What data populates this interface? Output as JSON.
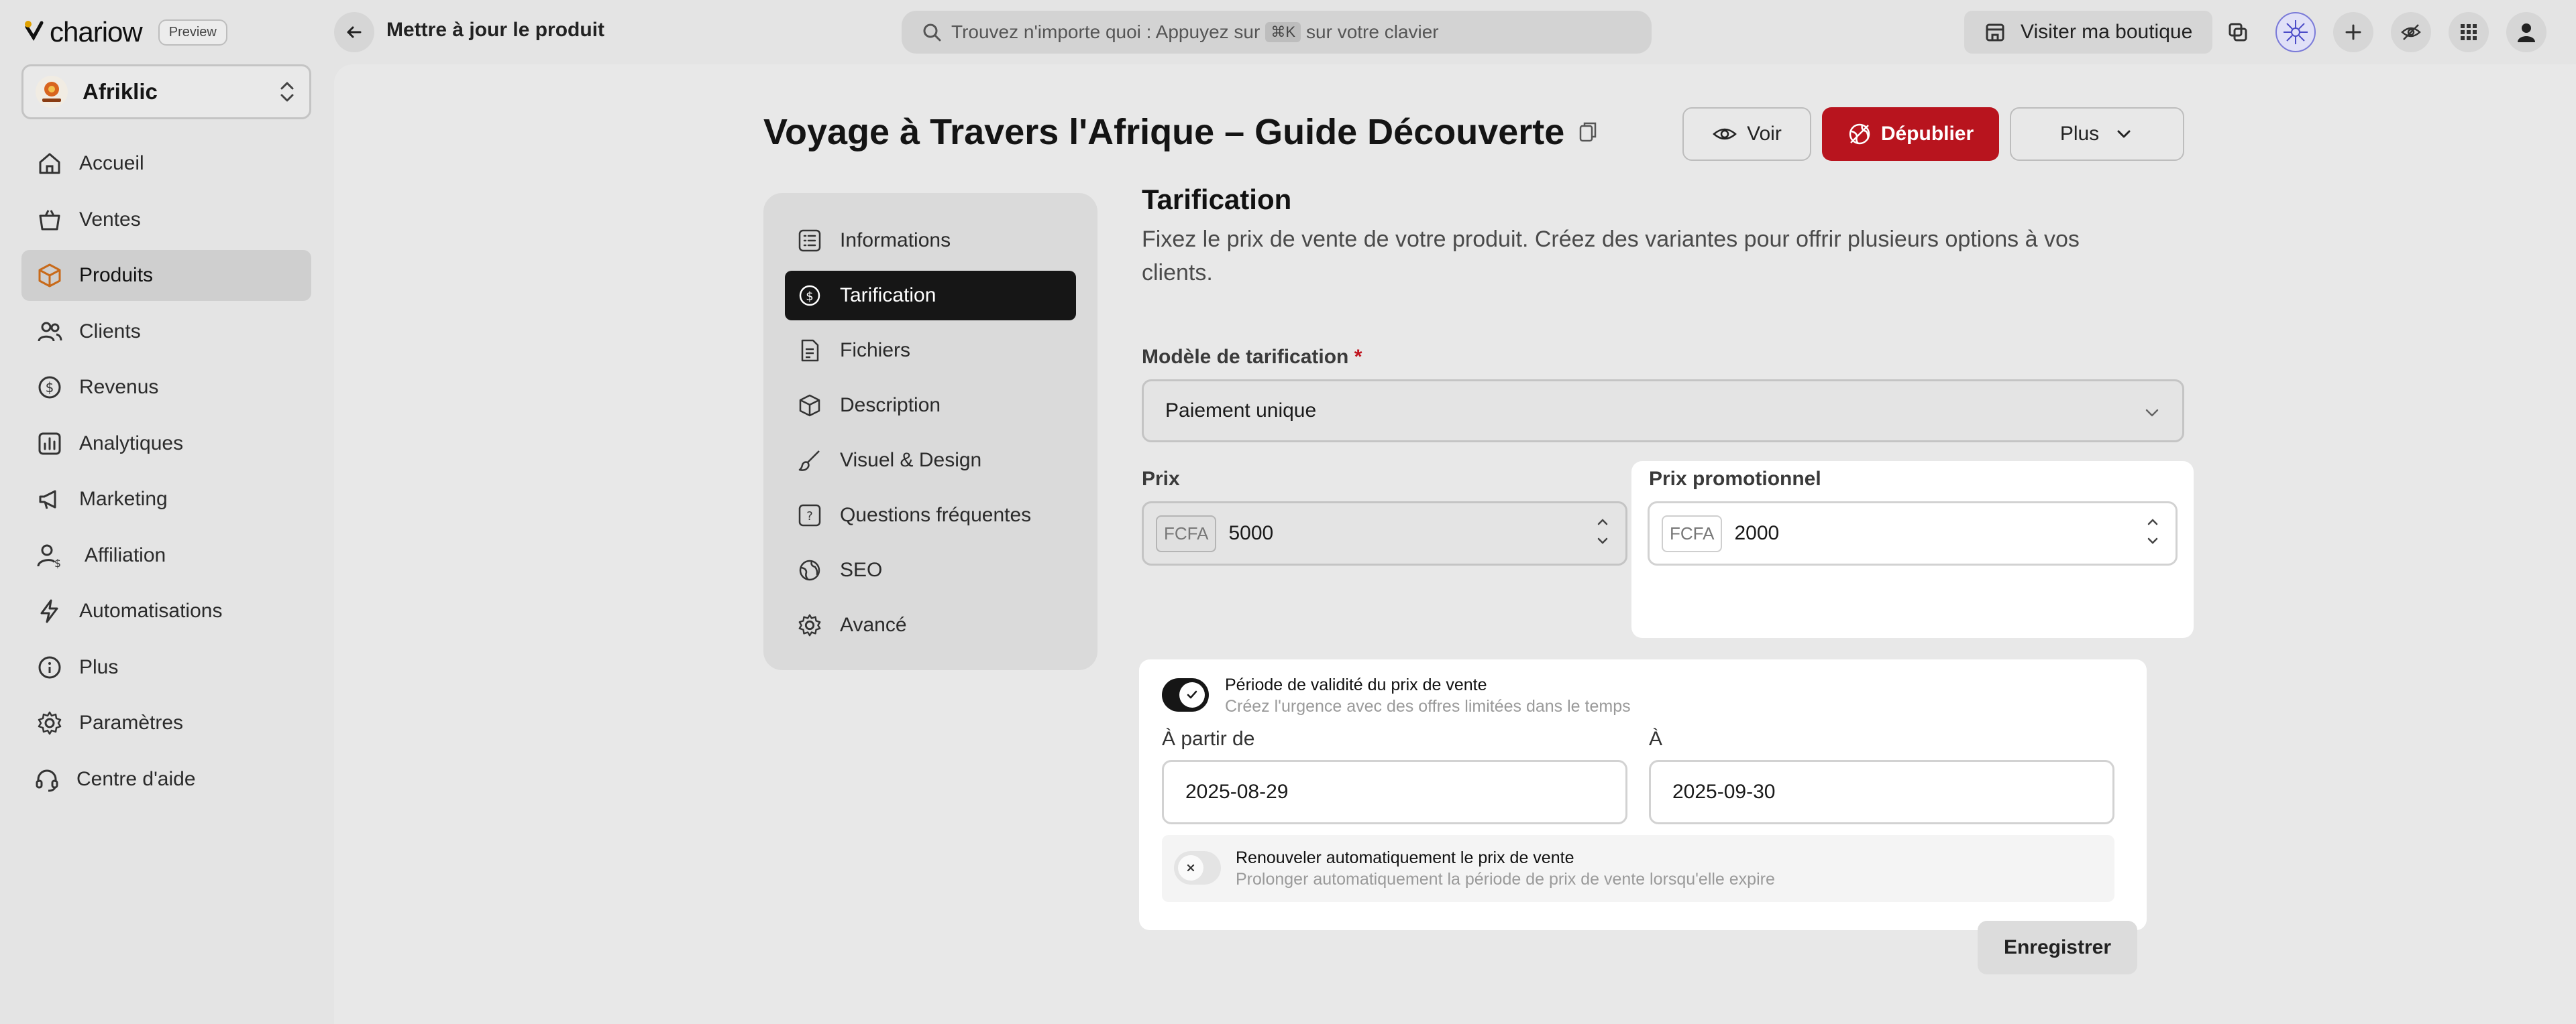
{
  "brand": {
    "name": "chariow",
    "preview_label": "Preview"
  },
  "store": {
    "name": "Afriklic",
    "avatar_text": "AfriKlic"
  },
  "sidebar": {
    "items": [
      {
        "label": "Accueil",
        "icon": "home-icon"
      },
      {
        "label": "Ventes",
        "icon": "shopping-basket-icon"
      },
      {
        "label": "Produits",
        "icon": "box-icon",
        "active": true
      },
      {
        "label": "Clients",
        "icon": "users-icon"
      },
      {
        "label": "Revenus",
        "icon": "coin-dollar-icon"
      },
      {
        "label": "Analytiques",
        "icon": "bar-chart-icon"
      },
      {
        "label": "Marketing",
        "icon": "megaphone-icon"
      },
      {
        "label": "Affiliation",
        "icon": "user-dollar-icon"
      },
      {
        "label": "Automatisations",
        "icon": "lightning-icon"
      },
      {
        "label": "Plus",
        "icon": "plus-circle-icon"
      },
      {
        "label": "Paramètres",
        "icon": "gear-icon"
      },
      {
        "label": "Centre d'aide",
        "icon": "headset-icon"
      }
    ]
  },
  "topbar": {
    "title": "Mettre à jour le produit",
    "search_prefix": "Trouvez n'importe quoi : Appuyez sur",
    "search_kbd": "⌘K",
    "search_suffix": "sur votre clavier",
    "visit_label": "Visiter ma boutique"
  },
  "product": {
    "title": "Voyage à Travers l'Afrique – Guide Découverte",
    "actions": {
      "view": "Voir",
      "unpublish": "Dépublier",
      "more": "Plus"
    }
  },
  "tabs": [
    {
      "label": "Informations",
      "icon": "list-icon"
    },
    {
      "label": "Tarification",
      "icon": "dollar-circle-icon",
      "active": true
    },
    {
      "label": "Fichiers",
      "icon": "file-icon"
    },
    {
      "label": "Description",
      "icon": "box-icon"
    },
    {
      "label": "Visuel & Design",
      "icon": "brush-icon"
    },
    {
      "label": "Questions fréquentes",
      "icon": "question-icon"
    },
    {
      "label": "SEO",
      "icon": "globe-icon"
    },
    {
      "label": "Avancé",
      "icon": "gear-icon"
    }
  ],
  "pricing": {
    "title": "Tarification",
    "description": "Fixez le prix de vente de votre produit. Créez des variantes pour offrir plusieurs options à vos clients.",
    "model_label": "Modèle de tarification",
    "required_mark": "*",
    "model_value": "Paiement unique",
    "price_label": "Prix",
    "currency": "FCFA",
    "price_value": "5000",
    "promo_label": "Prix promotionnel",
    "promo_value": "2000",
    "validity": {
      "enabled": true,
      "title": "Période de validité du prix de vente",
      "subtitle": "Créez l'urgence avec des offres limitées dans le temps",
      "from_label": "À partir de",
      "from_value": "2025-08-29",
      "to_label": "À",
      "to_value": "2025-09-30"
    },
    "renew": {
      "enabled": false,
      "title": "Renouveler automatiquement le prix de vente",
      "subtitle": "Prolonger automatiquement la période de prix de vente lorsqu'elle expire"
    },
    "save_label": "Enregistrer"
  },
  "colors": {
    "accent_red": "#b8141e",
    "active_tab": "#161616"
  }
}
